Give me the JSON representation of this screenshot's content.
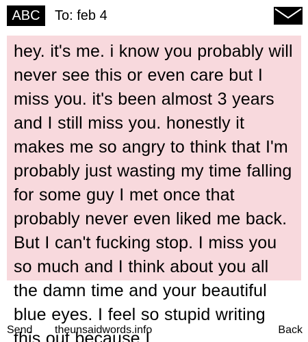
{
  "header": {
    "mode_label": "ABC",
    "recipient": "To: feb 4",
    "envelope_icon": "envelope-icon"
  },
  "message": {
    "body": "hey. it's me. i know you probably will never see this or even care but I miss you. it's been almost 3 years and I still miss you. honestly it makes me so angry to think that I'm probably just wasting my time falling for some guy I met once that probably never even liked me back. But I can't fucking stop. I miss you so much and I think about you all the damn time and your beautiful blue eyes. I feel so stupid writing this out because I",
    "background_color": "#f8d9dd"
  },
  "footer": {
    "send_label": "Send",
    "watermark": "theunsaidwords.info",
    "back_label": "Back"
  }
}
